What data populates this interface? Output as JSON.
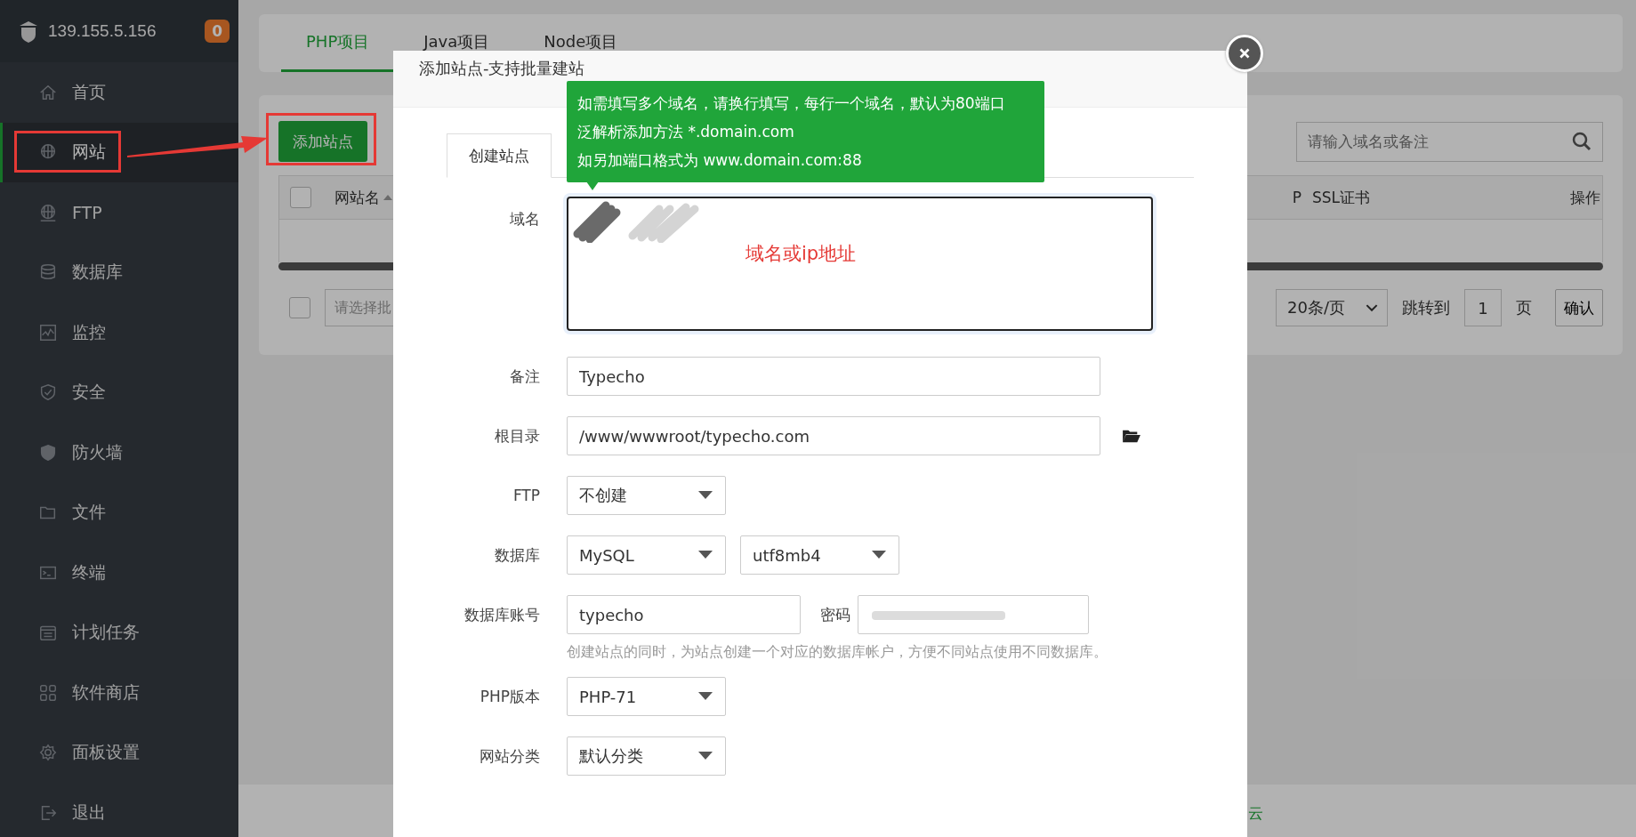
{
  "sidebar": {
    "host": "139.155.5.156",
    "badge": "0",
    "items": [
      {
        "label": "首页",
        "selected": false
      },
      {
        "label": "网站",
        "selected": true
      },
      {
        "label": "FTP",
        "selected": false
      },
      {
        "label": "数据库",
        "selected": false
      },
      {
        "label": "监控",
        "selected": false
      },
      {
        "label": "安全",
        "selected": false
      },
      {
        "label": "防火墙",
        "selected": false
      },
      {
        "label": "文件",
        "selected": false
      },
      {
        "label": "终端",
        "selected": false
      },
      {
        "label": "计划任务",
        "selected": false
      },
      {
        "label": "软件商店",
        "selected": false
      },
      {
        "label": "面板设置",
        "selected": false
      },
      {
        "label": "退出",
        "selected": false
      }
    ]
  },
  "project_tabs": [
    {
      "label": "PHP项目",
      "selected": true
    },
    {
      "label": "Java项目",
      "selected": false
    },
    {
      "label": "Node项目",
      "selected": false
    }
  ],
  "toolbar": {
    "add_button": "添加站点",
    "search": {
      "placeholder": "请输入域名或备注"
    }
  },
  "table": {
    "select_all_checked": false,
    "columns": [
      "网站名",
      "P",
      "SSL证书",
      "操作"
    ]
  },
  "pagination": {
    "select_checked": false,
    "batch_placeholder": "请选择批",
    "page_size": "20条/页",
    "jump_label": "跳转到",
    "page": "1",
    "page_unit": "页",
    "confirm": "确认"
  },
  "footer": {
    "text": "云"
  },
  "modal": {
    "title": "添加站点-支持批量建站",
    "tabs": [
      {
        "label": "创建站点",
        "selected": true
      }
    ],
    "tooltip": [
      "如需填写多个域名，请换行填写，每行一个域名，默认为80端口",
      "泛解析添加方法 *.domain.com",
      "如另加端口格式为 www.domain.com:88"
    ],
    "fields": [
      {
        "kind": "textarea",
        "label": "域名",
        "annotation": "域名或ip地址"
      },
      {
        "kind": "text",
        "label": "备注",
        "value": "Typecho"
      },
      {
        "kind": "path",
        "label": "根目录",
        "value": "/www/wwwroot/typecho.com"
      },
      {
        "kind": "select",
        "label": "FTP",
        "values": [
          "不创建"
        ]
      },
      {
        "kind": "select",
        "label": "数据库",
        "values": [
          "MySQL",
          "utf8mb4"
        ]
      },
      {
        "kind": "account",
        "label": "数据库账号",
        "value": "typecho",
        "password_label": "密码",
        "hint": "创建站点的同时，为站点创建一个对应的数据库帐户，方便不同站点使用不同数据库。"
      },
      {
        "kind": "select",
        "label": "PHP版本",
        "values": [
          "PHP-71"
        ]
      },
      {
        "kind": "select",
        "label": "网站分类",
        "values": [
          "默认分类"
        ]
      }
    ]
  }
}
